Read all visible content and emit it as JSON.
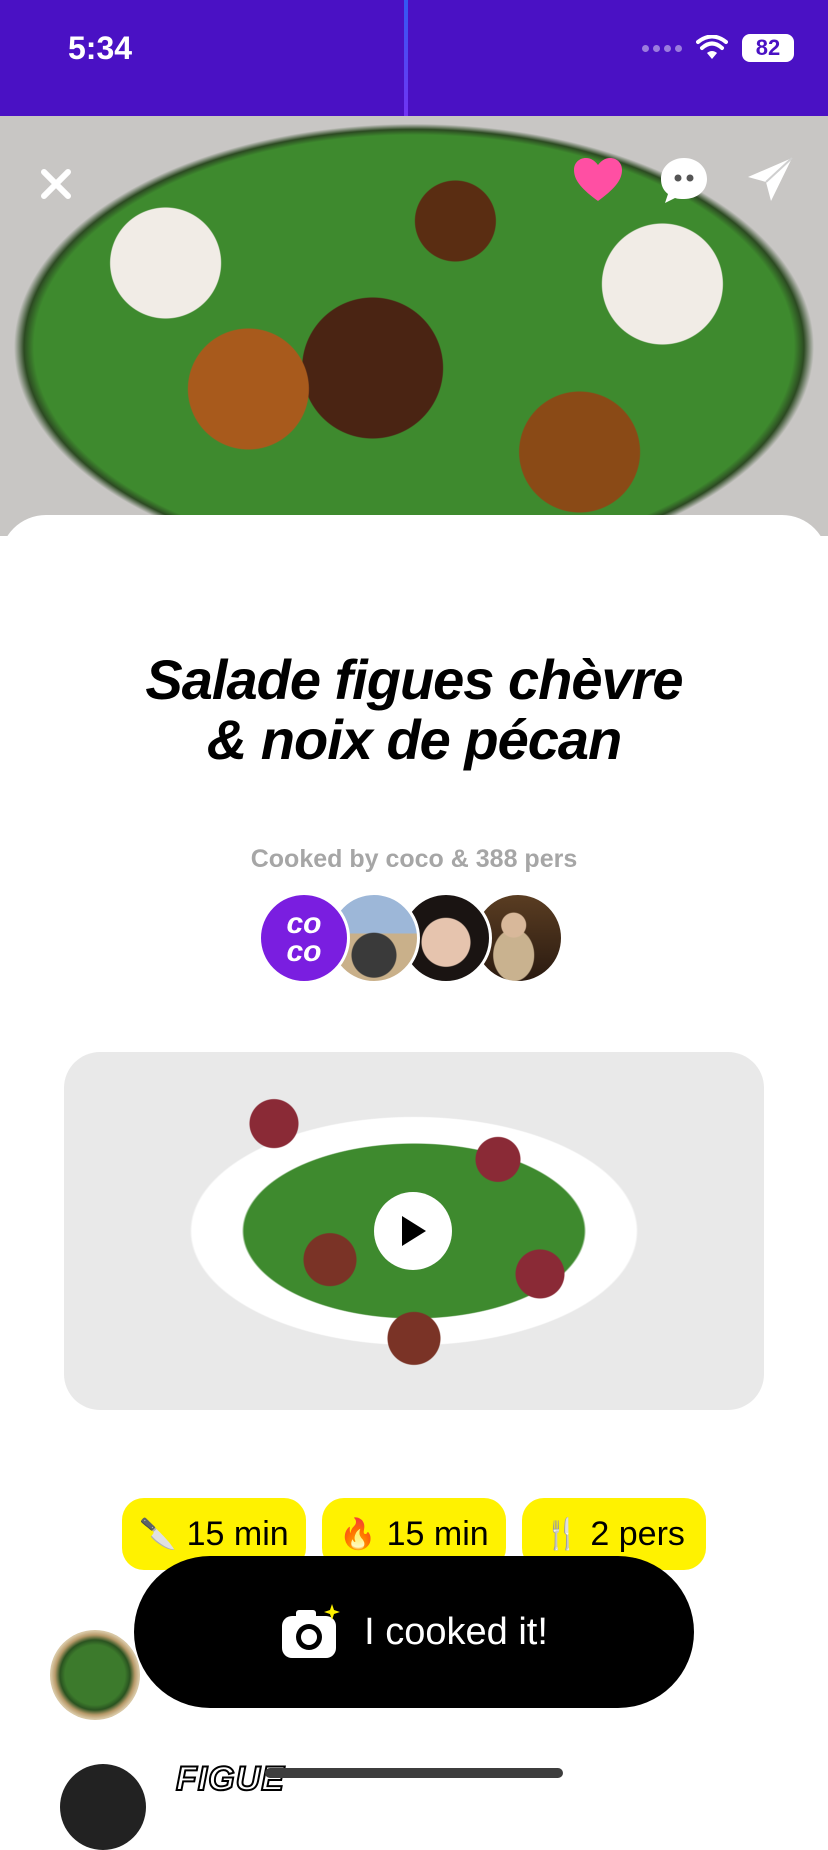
{
  "status_bar": {
    "time": "5:34",
    "battery": "82"
  },
  "hero": {
    "liked": true,
    "colors": {
      "heart": "#ff4fa3",
      "status_bar": "#4a11c4"
    }
  },
  "recipe": {
    "title_line1": "Salade figues chèvre",
    "title_line2": "& noix de pécan",
    "cooked_by": "Cooked by coco & 388 pers",
    "brand_avatar_text_top": "co",
    "brand_avatar_text_bottom": "co"
  },
  "chips": [
    {
      "emoji": "🔪",
      "label": "15 min",
      "icon": "knife-icon"
    },
    {
      "emoji": "🔥",
      "label": "15 min",
      "icon": "fire-icon"
    },
    {
      "emoji": "🍴",
      "label": "2 pers",
      "icon": "fork-knife-icon"
    }
  ],
  "cta": {
    "label": "I cooked it!"
  },
  "ingredients": {
    "first_label": "FIGUE"
  },
  "colors": {
    "chip_bg": "#fff200",
    "cta_bg": "#000000",
    "muted_text": "#a6a6a6"
  }
}
